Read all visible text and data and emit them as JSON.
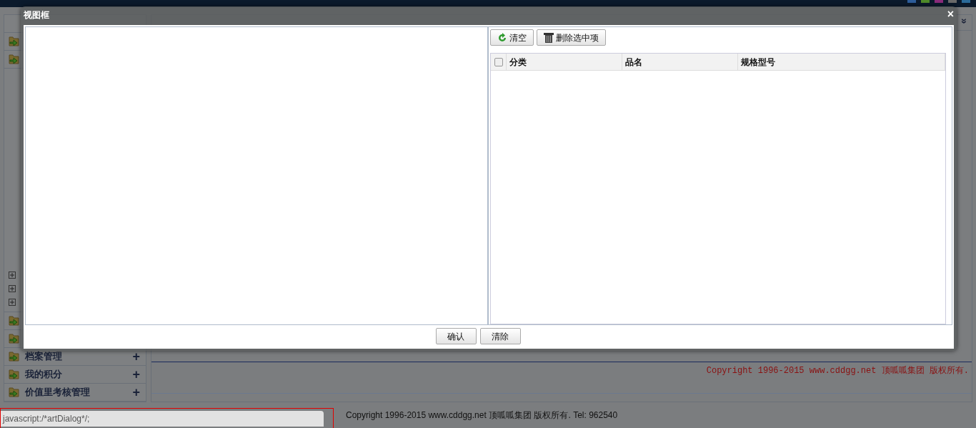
{
  "sidebar": {
    "items": [
      {
        "label": "档案管理",
        "toggle": "+"
      },
      {
        "label": "我的积分",
        "toggle": "+"
      },
      {
        "label": "价值里考核管理",
        "toggle": "+"
      }
    ]
  },
  "tab_menu_icon": "»",
  "content_footer": "Copyright 1996-2015 www.cddgg.net 顶呱呱集团 版权所有.",
  "page_footer": "Copyright 1996-2015 www.cddgg.net 顶呱呱集团 版权所有. Tel: 962540",
  "status_bar": "javascript:/*artDialog*/;",
  "dialog": {
    "title": "视图框",
    "close": "×",
    "toolbar": [
      {
        "kind": "refresh",
        "label": "清空"
      },
      {
        "kind": "trash",
        "label": "删除选中项"
      }
    ],
    "table": {
      "select_all": {
        "checked": false
      },
      "columns": [
        "分类",
        "品名",
        "规格型号"
      ]
    },
    "buttons": [
      "确认",
      "清除"
    ]
  }
}
